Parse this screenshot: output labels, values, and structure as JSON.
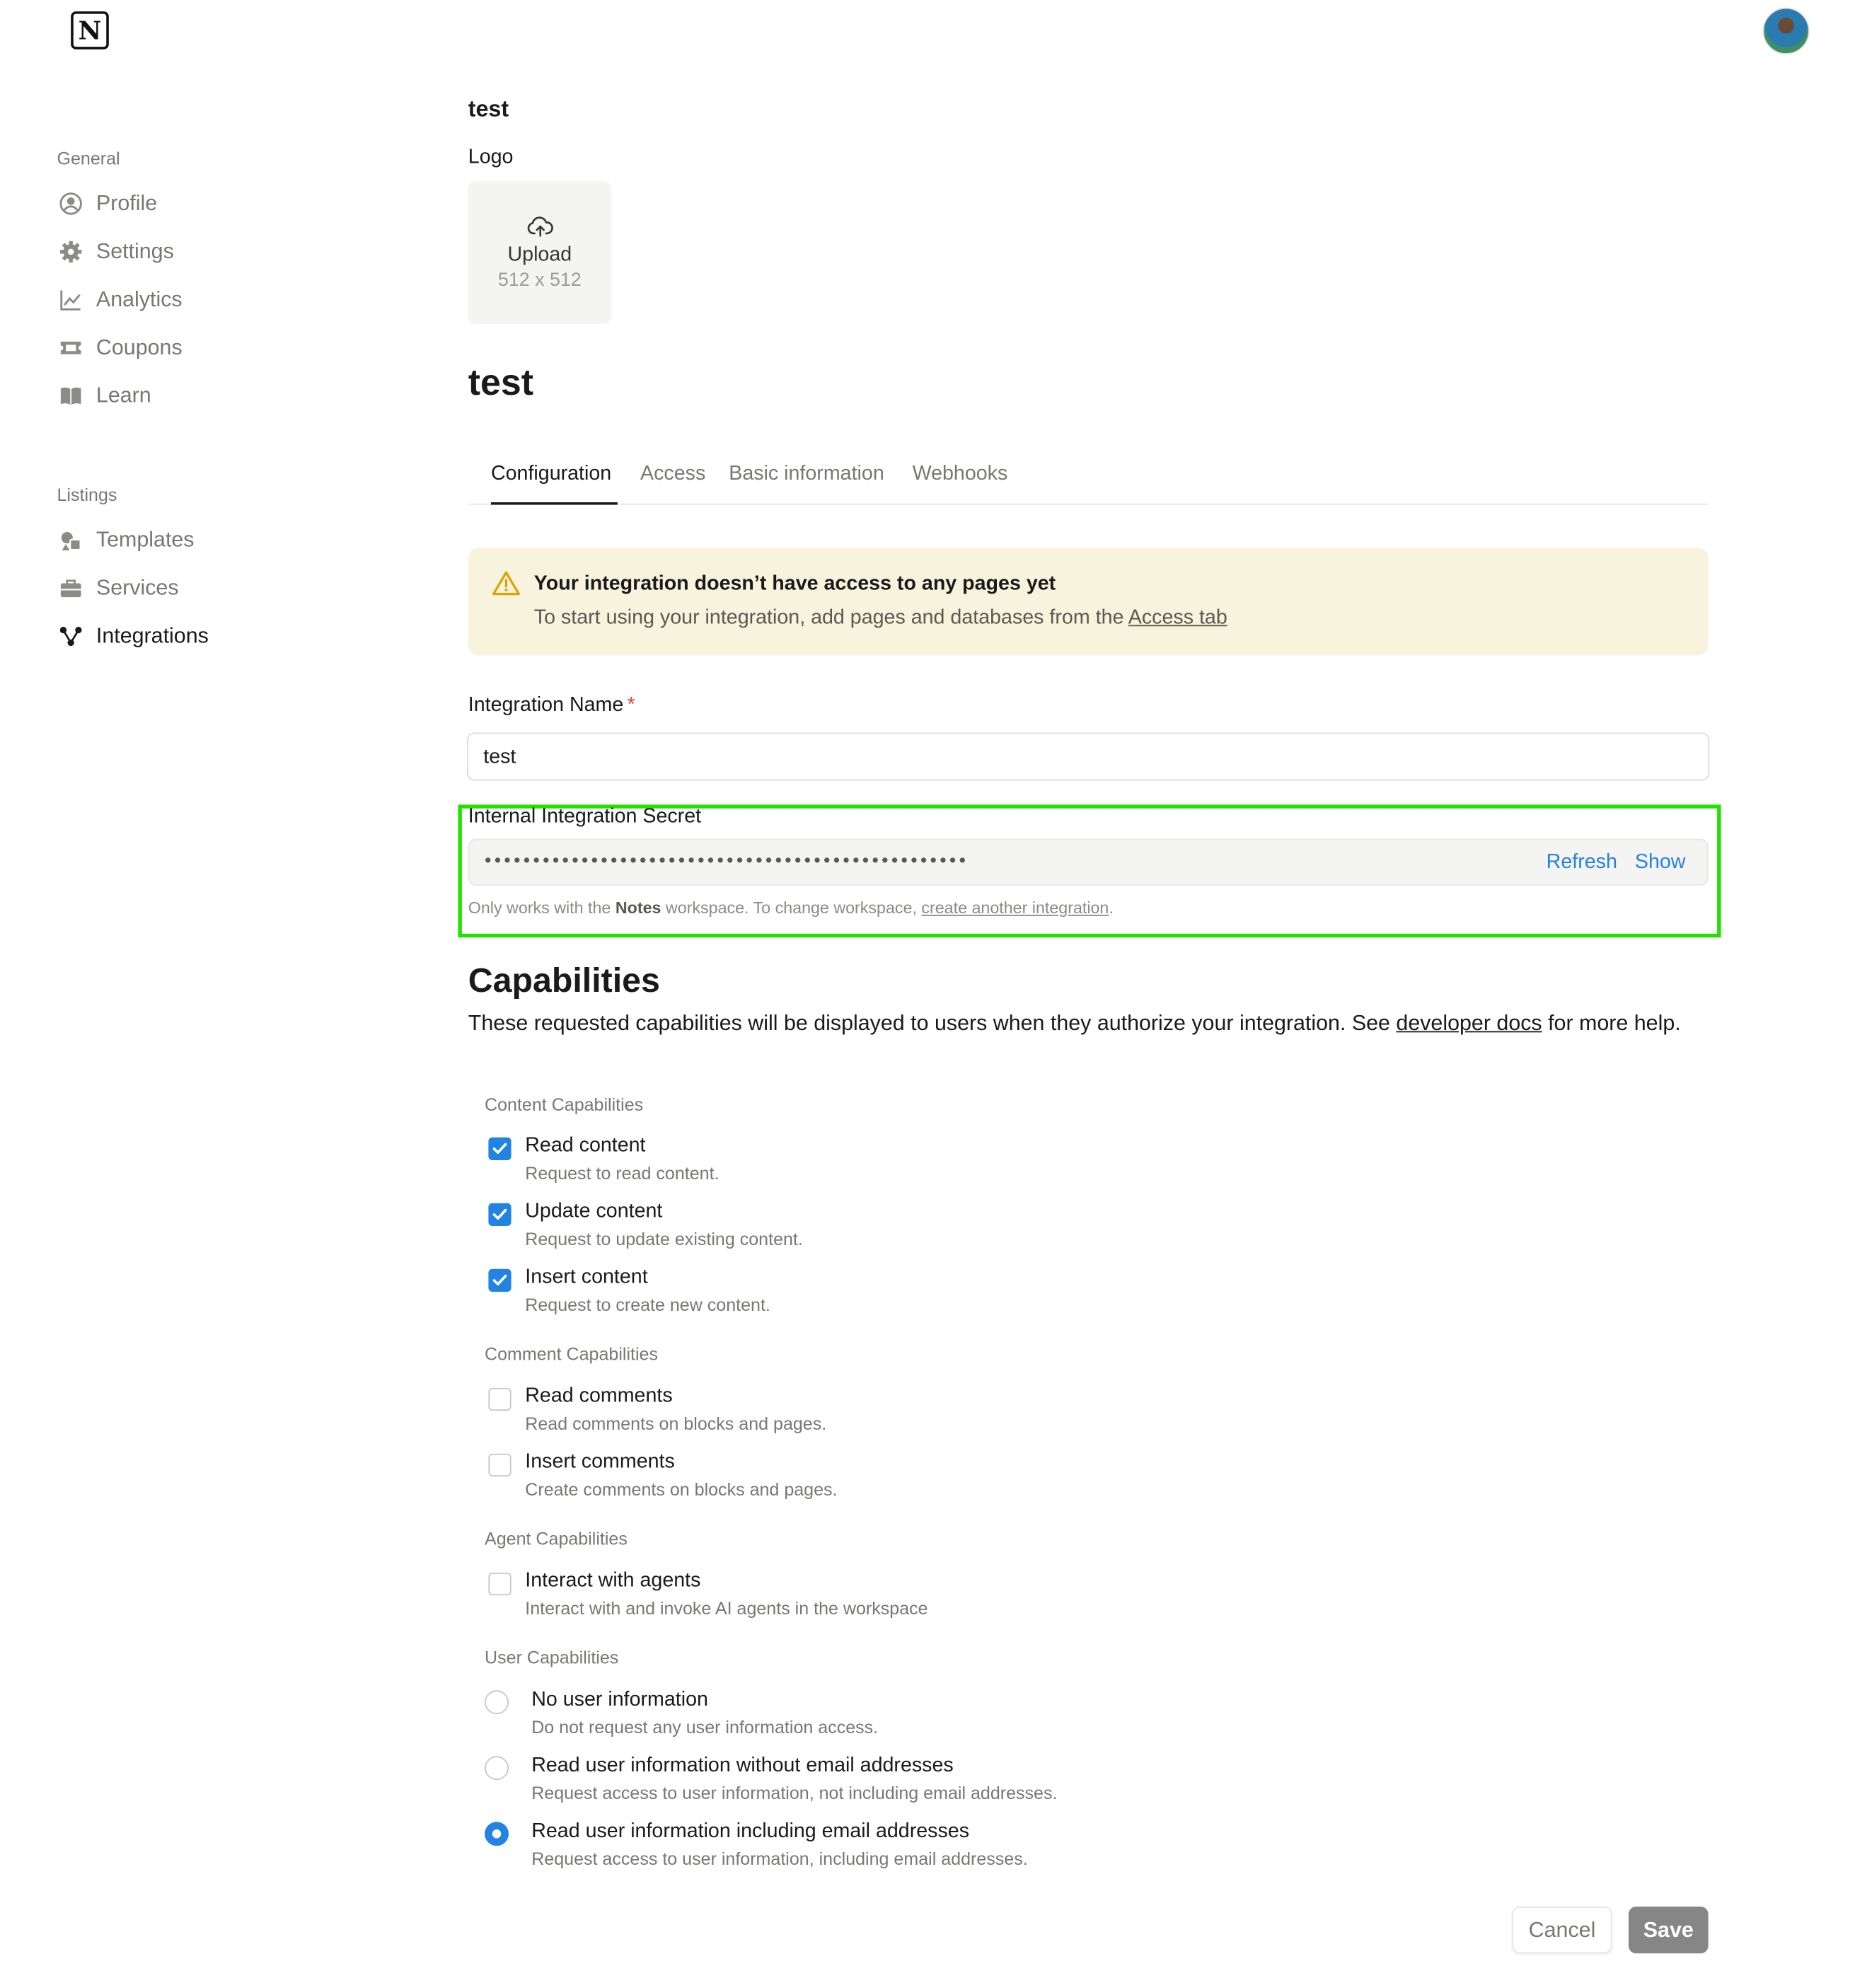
{
  "header": {
    "logo": "N",
    "logo_icon": "notion-logo-icon",
    "avatar_icon": "user-avatar"
  },
  "sidebar": {
    "general_label": "General",
    "general_items": [
      {
        "label": "Profile",
        "icon": "profile-icon"
      },
      {
        "label": "Settings",
        "icon": "gear-icon"
      },
      {
        "label": "Analytics",
        "icon": "chart-icon"
      },
      {
        "label": "Coupons",
        "icon": "coupon-icon"
      },
      {
        "label": "Learn",
        "icon": "book-icon"
      }
    ],
    "listings_label": "Listings",
    "listings_items": [
      {
        "label": "Templates",
        "icon": "templates-icon"
      },
      {
        "label": "Services",
        "icon": "briefcase-icon"
      },
      {
        "label": "Integrations",
        "icon": "integrations-icon",
        "active": true
      }
    ]
  },
  "main": {
    "small_title": "test",
    "logo_label": "Logo",
    "upload": {
      "label": "Upload",
      "size": "512 x 512",
      "icon": "cloud-upload-icon"
    },
    "title": "test",
    "tabs": [
      "Configuration",
      "Access",
      "Basic information",
      "Webhooks"
    ],
    "active_tab": "Configuration",
    "callout": {
      "icon": "warning-icon",
      "title": "Your integration doesn’t have access to any pages yet",
      "body_prefix": "To start using your integration, add pages and databases from the ",
      "body_link": "Access tab"
    },
    "integration_name": {
      "label": "Integration Name",
      "required_mark": "*",
      "value": "test"
    },
    "secret": {
      "label": "Internal Integration Secret",
      "masked_value": "••••••••••••••••••••••••••••••••••••••••••••••••••",
      "refresh_label": "Refresh",
      "show_label": "Show",
      "hint_prefix": "Only works with the ",
      "hint_workspace": "Notes",
      "hint_middle": " workspace. To change workspace, ",
      "hint_link": "create another integration",
      "hint_suffix": "."
    },
    "capabilities": {
      "title": "Capabilities",
      "desc_prefix": "These requested capabilities will be displayed to users when they authorize your integration. See ",
      "desc_link": "developer docs",
      "desc_suffix": " for more help.",
      "content": {
        "title": "Content Capabilities",
        "items": [
          {
            "title": "Read content",
            "desc": "Request to read content.",
            "checked": true
          },
          {
            "title": "Update content",
            "desc": "Request to update existing content.",
            "checked": true
          },
          {
            "title": "Insert content",
            "desc": "Request to create new content.",
            "checked": true
          }
        ]
      },
      "comment": {
        "title": "Comment Capabilities",
        "items": [
          {
            "title": "Read comments",
            "desc": "Read comments on blocks and pages.",
            "checked": false
          },
          {
            "title": "Insert comments",
            "desc": "Create comments on blocks and pages.",
            "checked": false
          }
        ]
      },
      "agent": {
        "title": "Agent Capabilities",
        "items": [
          {
            "title": "Interact with agents",
            "desc": "Interact with and invoke AI agents in the workspace",
            "checked": false
          }
        ]
      },
      "user": {
        "title": "User Capabilities",
        "items": [
          {
            "title": "No user information",
            "desc": "Do not request any user information access.",
            "selected": false
          },
          {
            "title": "Read user information without email addresses",
            "desc": "Request access to user information, not including email addresses.",
            "selected": false
          },
          {
            "title": "Read user information including email addresses",
            "desc": "Request access to user information, including email addresses.",
            "selected": true
          }
        ]
      }
    },
    "actions": {
      "cancel": "Cancel",
      "save": "Save"
    }
  },
  "colors": {
    "accent": "#2383e2",
    "highlight": "#22e000",
    "callout_bg": "#f7f3dc",
    "save_bg": "#868686"
  }
}
